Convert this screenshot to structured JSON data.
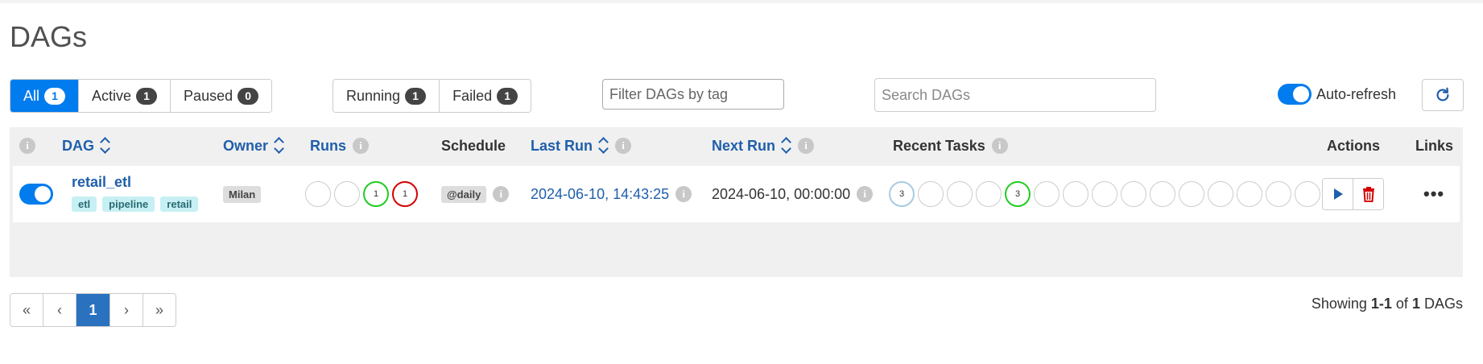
{
  "page": {
    "title": "DAGs"
  },
  "status_filters": [
    {
      "label": "All",
      "count": "1"
    },
    {
      "label": "Active",
      "count": "1"
    },
    {
      "label": "Paused",
      "count": "0"
    }
  ],
  "run_filters": [
    {
      "label": "Running",
      "count": "1"
    },
    {
      "label": "Failed",
      "count": "1"
    }
  ],
  "tag_filter": {
    "placeholder": "Filter DAGs by tag"
  },
  "search": {
    "placeholder": "Search DAGs"
  },
  "auto_refresh": {
    "label": "Auto-refresh",
    "enabled": true
  },
  "table": {
    "headers": {
      "dag": "DAG",
      "owner": "Owner",
      "runs": "Runs",
      "schedule": "Schedule",
      "last_run": "Last Run",
      "next_run": "Next Run",
      "recent_tasks": "Recent Tasks",
      "actions": "Actions",
      "links": "Links"
    },
    "rows": [
      {
        "active": true,
        "dag_id": "retail_etl",
        "tags": [
          "etl",
          "pipeline",
          "retail"
        ],
        "owner": "Milan",
        "runs": [
          {
            "count": "",
            "state": "none"
          },
          {
            "count": "",
            "state": "none"
          },
          {
            "count": "1",
            "state": "success"
          },
          {
            "count": "1",
            "state": "failed"
          }
        ],
        "schedule": "@daily",
        "last_run": "2024-06-10, 14:43:25",
        "next_run": "2024-06-10, 00:00:00",
        "recent_tasks": [
          "3",
          "",
          "",
          "",
          "3",
          "",
          "",
          "",
          "",
          "",
          "",
          "",
          "",
          "",
          ""
        ],
        "recent_task_states": [
          "lightblue",
          "none",
          "none",
          "none",
          "success",
          "none",
          "none",
          "none",
          "none",
          "none",
          "none",
          "none",
          "none",
          "none",
          "none"
        ],
        "links_label": "•••"
      }
    ]
  },
  "pagination": {
    "first": "«",
    "prev": "‹",
    "current": "1",
    "next": "›",
    "last": "»"
  },
  "showing": {
    "prefix": "Showing",
    "range": "1-1",
    "of": "of",
    "total": "1",
    "suffix": "DAGs"
  },
  "colors": {
    "accent": "#017cee",
    "link": "#1f5faa",
    "success": "#21cc21",
    "failed": "#d40000",
    "delete": "#d40000"
  },
  "icons": [
    "info-icon",
    "sort-icon",
    "refresh-icon",
    "play-icon",
    "trash-icon",
    "more-dots-icon"
  ]
}
